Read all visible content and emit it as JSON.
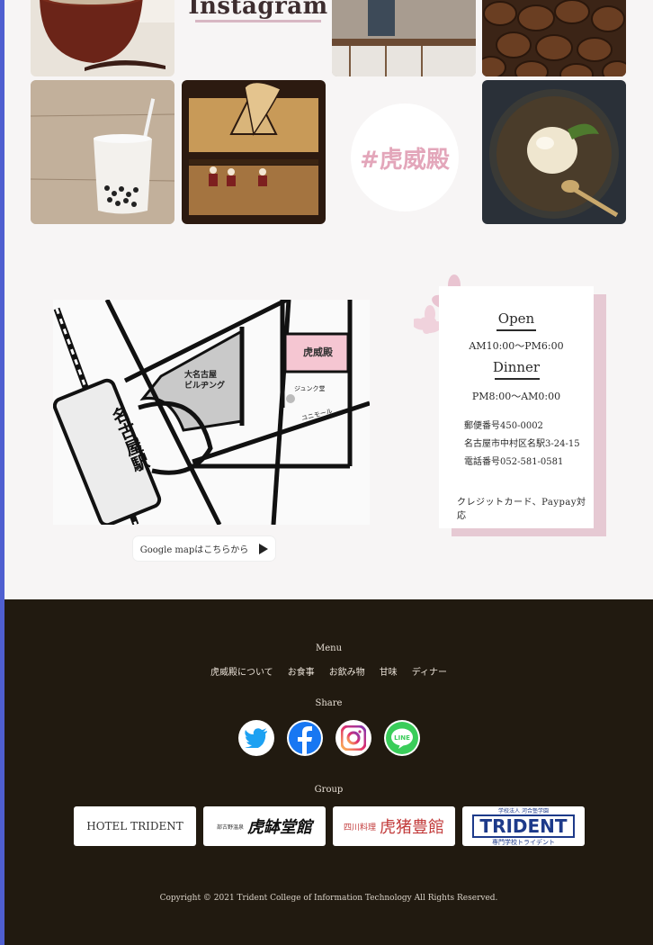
{
  "instagram": {
    "title": "Instagram",
    "hashtag": "#虎威殿"
  },
  "map": {
    "station": "名古屋駅",
    "building": "大名古屋\nビルヂング",
    "shop": "虎威殿",
    "junkudo": "ジュンク堂",
    "unimall": "ユニモール",
    "google_button": "Google mapはこちらから"
  },
  "info": {
    "open_title": "Open",
    "open_hours": "AM10:00～PM6:00",
    "dinner_title": "Dinner",
    "dinner_hours": "PM8:00～AM0:00",
    "postal": "郵便番号450-0002",
    "address": "名古屋市中村区名駅3-24-15",
    "phone": "電話番号052-581-0581",
    "credit": "クレジットカード、Paypay対応"
  },
  "footer": {
    "menu_label": "Menu",
    "menu_items": [
      "虎威殿について",
      "お食事",
      "お飲み物",
      "甘味",
      "ディナー"
    ],
    "share_label": "Share",
    "group_label": "Group",
    "groups": [
      "HOTEL TRIDENT",
      "虎缽堂館",
      "虎猪豊館",
      "TRIDENT"
    ],
    "group_sub": {
      "toranabe_prefix": "部古野温泉",
      "torainoshishi_prefix": "四川料理",
      "trident_top": "学校法人 河合塾学園",
      "trident_bottom": "専門学校トライデント"
    },
    "copyright": "Copyright © 2021 Trident College of Information Technology All Rights Reserved."
  },
  "colors": {
    "accent_pink": "#e3a6ba",
    "card_shadow": "#e6c9d3",
    "footer_bg": "#211a10",
    "twitter": "#1da1f2",
    "facebook": "#1877f2",
    "line": "#3acd5a"
  }
}
